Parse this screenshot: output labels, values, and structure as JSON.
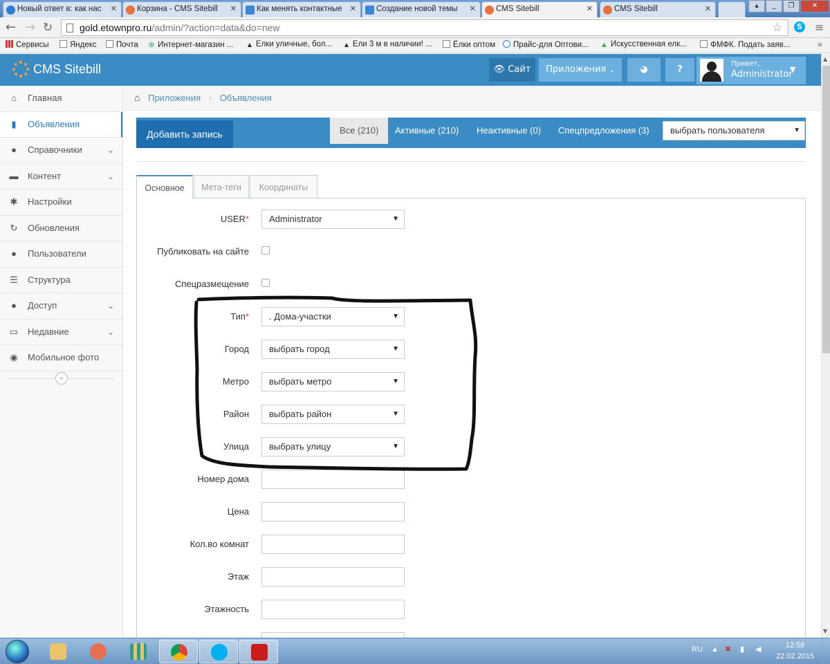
{
  "browser": {
    "tabs": [
      {
        "title": "Новый ответ в: как нас",
        "icon": "at-icon"
      },
      {
        "title": "Корзина - CMS Sitebill",
        "icon": "sitebill-icon"
      },
      {
        "title": "Как менять контактные",
        "icon": "doc-icon"
      },
      {
        "title": "Создание новой темы",
        "icon": "doc-icon"
      },
      {
        "title": "CMS Sitebill",
        "icon": "sitebill-icon"
      },
      {
        "title": "CMS Sitebill",
        "icon": "sitebill-icon"
      }
    ],
    "url_host": "gold.etownpro.ru",
    "url_path": "/admin/?action=data&do=new",
    "bookmarks": [
      "Сервисы",
      "Яндекс",
      "Почта",
      "Интернет-магазин ...",
      "Елки уличные, бол...",
      "Ели 3 м в наличии! ...",
      "Ёлки оптом",
      "Прайс-для Оптови...",
      "Искусственная елк...",
      "ФМФК. Подать заяв..."
    ],
    "more": "»"
  },
  "header": {
    "logo": "CMS Sitebill",
    "site_btn": "Сайт",
    "apps_btn": "Приложения",
    "hello": "Привет,",
    "username": "Administrator"
  },
  "sidebar": {
    "items": [
      {
        "label": "Главная",
        "icon": "home-icon",
        "glyph": "⌂"
      },
      {
        "label": "Объявления",
        "icon": "book-icon",
        "glyph": "▮"
      },
      {
        "label": "Справочники",
        "icon": "globe-icon",
        "glyph": "●"
      },
      {
        "label": "Контент",
        "icon": "coffee-icon",
        "glyph": "▬"
      },
      {
        "label": "Настройки",
        "icon": "gear-icon",
        "glyph": "✱"
      },
      {
        "label": "Обновления",
        "icon": "refresh-icon",
        "glyph": "↻"
      },
      {
        "label": "Пользователи",
        "icon": "user-icon",
        "glyph": "●"
      },
      {
        "label": "Структура",
        "icon": "list-icon",
        "glyph": "☰"
      },
      {
        "label": "Доступ",
        "icon": "group-icon",
        "glyph": "●"
      },
      {
        "label": "Недавние",
        "icon": "desktop-icon",
        "glyph": "▭"
      },
      {
        "label": "Мобильное фото",
        "icon": "camera-icon",
        "glyph": "◉"
      }
    ],
    "collapse": "«"
  },
  "breadcrumb": {
    "items": [
      "Приложения",
      "Объявления"
    ]
  },
  "actions": {
    "add": "Добавить запись",
    "filters": [
      "Все (210)",
      "Активные (210)",
      "Неактивные (0)",
      "Спецпредложения (3)"
    ],
    "user_select": "выбрать пользователя"
  },
  "form": {
    "tabs": [
      "Основное",
      "Мета-теги",
      "Координаты"
    ],
    "fields": [
      {
        "label": "USER",
        "required": "*",
        "type": "select",
        "value": "Administrator"
      },
      {
        "label": "Публиковать на сайте",
        "required": "",
        "type": "checkbox",
        "value": ""
      },
      {
        "label": "Спецразмещение",
        "required": "",
        "type": "checkbox",
        "value": ""
      },
      {
        "label": "Тип",
        "required": "*",
        "type": "select",
        "value": ". Дома-участки"
      },
      {
        "label": "Город",
        "required": "",
        "type": "select",
        "value": "выбрать город"
      },
      {
        "label": "Метро",
        "required": "",
        "type": "select",
        "value": "выбрать метро"
      },
      {
        "label": "Район",
        "required": "",
        "type": "select",
        "value": "выбрать район"
      },
      {
        "label": "Улица",
        "required": "",
        "type": "select",
        "value": "выбрать улицу"
      },
      {
        "label": "Номер дома",
        "required": "",
        "type": "text",
        "value": ""
      },
      {
        "label": "Цена",
        "required": "",
        "type": "text",
        "value": ""
      },
      {
        "label": "Кол.во комнат",
        "required": "",
        "type": "text",
        "value": ""
      },
      {
        "label": "Этаж",
        "required": "",
        "type": "text",
        "value": ""
      },
      {
        "label": "Этажность",
        "required": "",
        "type": "text",
        "value": ""
      }
    ]
  },
  "taskbar": {
    "lang": "RU",
    "time": "12:58",
    "date": "22.02.2015"
  },
  "colors": {
    "header": "#3b8cc4",
    "accent": "#2b7dbc",
    "required": "#dd4444"
  }
}
